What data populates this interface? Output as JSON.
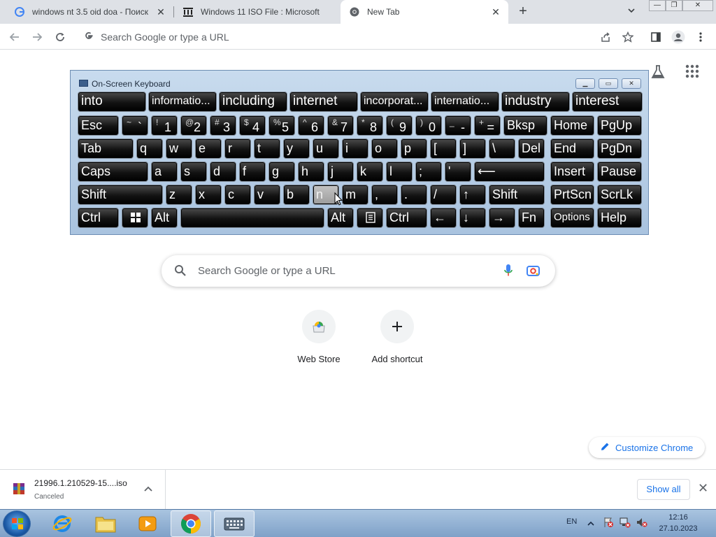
{
  "tabs": [
    {
      "title": "windows nt 3.5 oid doa - Поиск"
    },
    {
      "title": "Windows 11 ISO File : Microsoft"
    },
    {
      "title": "New Tab"
    }
  ],
  "omnibox": {
    "placeholder": "Search Google or type a URL"
  },
  "ntp": {
    "search_placeholder": "Search Google or type a URL",
    "shortcuts": [
      {
        "label": "Web Store"
      },
      {
        "label": "Add shortcut"
      }
    ],
    "customize_label": "Customize Chrome"
  },
  "osk": {
    "title": "On-Screen Keyboard",
    "predictions": [
      "into",
      "informatio...",
      "including",
      "internet",
      "incorporat...",
      "internatio...",
      "industry",
      "interest"
    ],
    "row1": [
      {
        "main": "Esc"
      },
      {
        "sup": "~",
        "main": "`"
      },
      {
        "sup": "!",
        "main": "1"
      },
      {
        "sup": "@",
        "main": "2"
      },
      {
        "sup": "#",
        "main": "3"
      },
      {
        "sup": "$",
        "main": "4"
      },
      {
        "sup": "%",
        "main": "5"
      },
      {
        "sup": "^",
        "main": "6"
      },
      {
        "sup": "&",
        "main": "7"
      },
      {
        "sup": "*",
        "main": "8"
      },
      {
        "sup": "(",
        "main": "9"
      },
      {
        "sup": ")",
        "main": "0"
      },
      {
        "sup": "_",
        "main": "-"
      },
      {
        "sup": "+",
        "main": "="
      },
      {
        "main": "Bksp"
      },
      {
        "main": "Home"
      },
      {
        "main": "PgUp"
      }
    ],
    "row2": [
      "Tab",
      "q",
      "w",
      "e",
      "r",
      "t",
      "y",
      "u",
      "i",
      "o",
      "p",
      "[",
      "]",
      "\\",
      "Del",
      "End",
      "PgDn"
    ],
    "row3": [
      "Caps",
      "a",
      "s",
      "d",
      "f",
      "g",
      "h",
      "j",
      "k",
      "l",
      ";",
      "'",
      "⟵",
      "Insert",
      "Pause"
    ],
    "row4": [
      "Shift",
      "z",
      "x",
      "c",
      "v",
      "b",
      "n",
      "m",
      ",",
      ".",
      "/",
      "↑",
      "Shift",
      "PrtScn",
      "ScrLk"
    ],
    "row5": [
      "Ctrl",
      "",
      "Alt",
      "",
      "Alt",
      "",
      "Ctrl",
      "←",
      "↓",
      "→",
      "Fn",
      "Options",
      "Help"
    ]
  },
  "download": {
    "filename": "21996.1.210529-15....iso",
    "status": "Canceled",
    "show_all": "Show all"
  },
  "taskbar": {
    "lang": "EN",
    "time": "12:16",
    "date": "27.10.2023"
  },
  "colors": {
    "accent": "#1a73e8",
    "osk_key": "#121212",
    "tabstrip": "#dee1e6"
  }
}
